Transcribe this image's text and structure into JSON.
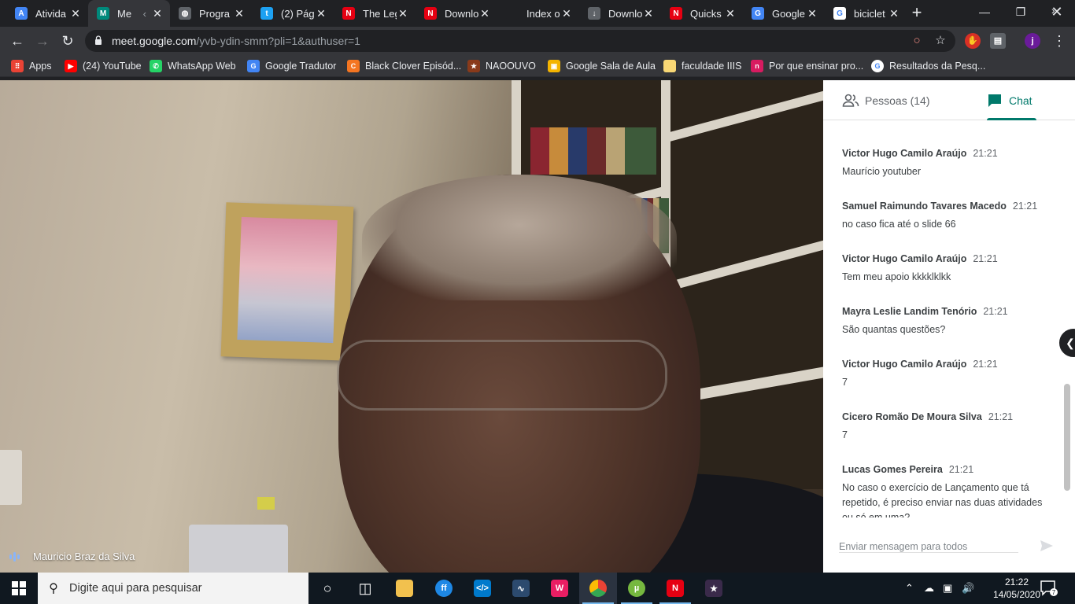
{
  "browser": {
    "tabs": [
      {
        "title": "Ativida",
        "favicon": "classroom-icon",
        "color": "#4285f4",
        "glyph": "A"
      },
      {
        "title": "Me",
        "favicon": "meet-icon",
        "color": "#00897b",
        "glyph": "M",
        "active": true
      },
      {
        "title": "Progra",
        "favicon": "globe-icon",
        "color": "#5f6368",
        "glyph": "◍"
      },
      {
        "title": "(2) Pág",
        "favicon": "twitter-icon",
        "color": "#1da1f2",
        "glyph": "t"
      },
      {
        "title": "The Leg",
        "favicon": "nintendo-icon",
        "color": "#e60012",
        "glyph": "N"
      },
      {
        "title": "Downlo",
        "favicon": "nintendo-icon",
        "color": "#e60012",
        "glyph": "N"
      },
      {
        "title": "Index o",
        "favicon": "blank-icon",
        "color": "#202124",
        "glyph": ""
      },
      {
        "title": "Downlo",
        "favicon": "download-icon",
        "color": "#5f6368",
        "glyph": "↓"
      },
      {
        "title": "Quicks",
        "favicon": "nintendo-icon",
        "color": "#e60012",
        "glyph": "N"
      },
      {
        "title": "Google",
        "favicon": "google-translate-icon",
        "color": "#4285f4",
        "glyph": "G"
      },
      {
        "title": "biciclet",
        "favicon": "google-icon",
        "color": "#ffffff",
        "glyph": "G"
      }
    ],
    "url_host": "meet.google.com",
    "url_path": "/yvb-ydin-smm?pli=1&authuser=1",
    "profile_initial": "j",
    "bookmarks": [
      {
        "label": "Apps",
        "icon": "apps-grid-icon",
        "color": "#ea4335",
        "glyph": "⠿"
      },
      {
        "label": "(24) YouTube",
        "icon": "youtube-icon",
        "color": "#ff0000",
        "glyph": "▶"
      },
      {
        "label": "WhatsApp Web",
        "icon": "whatsapp-icon",
        "color": "#25d366",
        "glyph": "✆"
      },
      {
        "label": "Google Tradutor",
        "icon": "google-translate-icon",
        "color": "#4285f4",
        "glyph": "G"
      },
      {
        "label": "Black Clover Episód...",
        "icon": "crunchyroll-icon",
        "color": "#f47521",
        "glyph": "C"
      },
      {
        "label": "NAOOUVO",
        "icon": "game-icon",
        "color": "#8a3a1a",
        "glyph": "★"
      },
      {
        "label": "Google Sala de Aula",
        "icon": "classroom-icon",
        "color": "#f4b400",
        "glyph": "▣"
      },
      {
        "label": "faculdade IIIS",
        "icon": "folder-icon",
        "color": "#f8d775",
        "glyph": ""
      },
      {
        "label": "Por que ensinar pro...",
        "icon": "n-icon",
        "color": "#d81b60",
        "glyph": "n"
      },
      {
        "label": "Resultados da Pesq...",
        "icon": "google-icon",
        "color": "#ffffff",
        "glyph": "G"
      }
    ]
  },
  "meet": {
    "speaker_name": "Mauricio Braz da Silva",
    "tabs": {
      "people": "Pessoas (14)",
      "chat": "Chat"
    },
    "messages": [
      {
        "author": "Victor Hugo Camilo Araújo",
        "time": "21:21",
        "text": "Maurício youtuber"
      },
      {
        "author": "Samuel Raimundo Tavares Macedo",
        "time": "21:21",
        "text": "no caso fica até o slide 66"
      },
      {
        "author": "Victor Hugo Camilo Araújo",
        "time": "21:21",
        "text": "Tem meu apoio kkkklklkk"
      },
      {
        "author": "Mayra Leslie Landim Tenório",
        "time": "21:21",
        "text": "São quantas questões?"
      },
      {
        "author": "Victor Hugo Camilo Araújo",
        "time": "21:21",
        "text": "7"
      },
      {
        "author": "Cicero Romão De Moura Silva",
        "time": "21:21",
        "text": "7"
      },
      {
        "author": "Lucas Gomes Pereira",
        "time": "21:21",
        "text": "No caso o exercício de Lançamento que tá repetido, é preciso enviar nas duas atividades ou só em uma?"
      }
    ],
    "compose_placeholder": "Enviar mensagem para todos"
  },
  "taskbar": {
    "search_placeholder": "Digite aqui para pesquisar",
    "time": "21:22",
    "date": "14/05/2020",
    "notification_count": "7"
  }
}
